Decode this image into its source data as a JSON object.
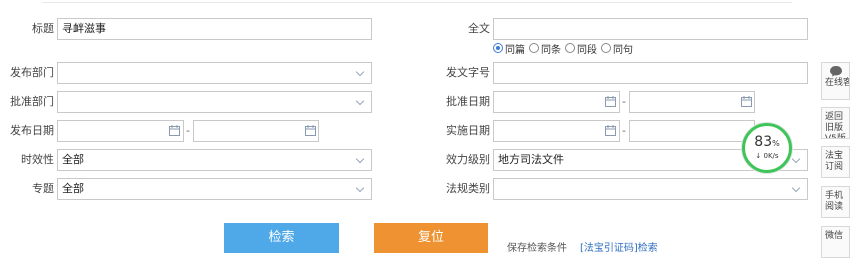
{
  "form": {
    "title": {
      "label": "标题",
      "value": "寻衅滋事"
    },
    "fulltext": {
      "label": "全文",
      "value": ""
    },
    "match_options": [
      {
        "label": "同篇",
        "selected": true
      },
      {
        "label": "同条",
        "selected": false
      },
      {
        "label": "同段",
        "selected": false
      },
      {
        "label": "同句",
        "selected": false
      }
    ],
    "issuing_dept": {
      "label": "发布部门",
      "value": ""
    },
    "doc_number": {
      "label": "发文字号",
      "value": ""
    },
    "approving_dept": {
      "label": "批准部门",
      "value": ""
    },
    "approval_date": {
      "label": "批准日期",
      "from": "",
      "to": ""
    },
    "publish_date": {
      "label": "发布日期",
      "from": "",
      "to": ""
    },
    "effective_date": {
      "label": "实施日期",
      "from": "",
      "to": ""
    },
    "validity": {
      "label": "时效性",
      "value": "全部"
    },
    "effect_level": {
      "label": "效力级别",
      "value": "地方司法文件"
    },
    "topic": {
      "label": "专题",
      "value": "全部"
    },
    "category": {
      "label": "法规类别",
      "value": ""
    },
    "range_separator": "-"
  },
  "actions": {
    "search": "检索",
    "reset": "复位",
    "save_search": "保存检索条件",
    "code_search": "[法宝引证码]检索"
  },
  "sidebar": {
    "online": "在线客服",
    "items": [
      "返回旧版 V5版",
      "法宝订阅",
      "手机阅读",
      "微信"
    ]
  },
  "speed_widget": {
    "percent": "83",
    "unit": "%",
    "speed": "0K/s"
  },
  "colors": {
    "search_button": "#4fa8e8",
    "reset_button": "#ef9232",
    "accent": "#3b7bd5",
    "ring": "#3ec55a"
  }
}
